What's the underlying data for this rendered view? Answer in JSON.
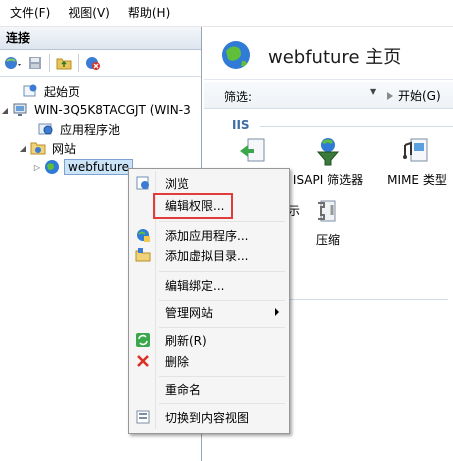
{
  "menubar": {
    "items": [
      "文件(F)",
      "视图(V)",
      "帮助(H)"
    ]
  },
  "connections": {
    "title": "连接",
    "tree": [
      {
        "label": "起始页",
        "icon": "start-page-icon"
      },
      {
        "label": "WIN-3Q5K8TACGJT (WIN-3",
        "icon": "server-icon"
      },
      {
        "label": "应用程序池",
        "icon": "app-pool-icon"
      },
      {
        "label": "网站",
        "icon": "sites-folder-icon"
      },
      {
        "label": "webfuture",
        "icon": "globe-icon"
      }
    ]
  },
  "home": {
    "title": "webfuture 主页",
    "filter_label": "筛选:",
    "start_label": "开始(G)",
    "group_iis": "IIS",
    "features": [
      {
        "label": "ISAPI 筛选器",
        "icon": "isapi-filter-icon"
      },
      {
        "label": "MIME 类型",
        "icon": "mime-types-icon"
      },
      {
        "label": "压缩",
        "icon": "compression-icon"
      }
    ],
    "partial_feature_label": "示"
  },
  "context_menu": {
    "items": [
      {
        "label": "浏览",
        "icon": "browse-icon"
      },
      {
        "label": "编辑权限...",
        "icon": ""
      },
      {
        "label": "添加应用程序...",
        "icon": "add-application-icon"
      },
      {
        "label": "添加虚拟目录...",
        "icon": "add-virtual-dir-icon"
      },
      {
        "label": "编辑绑定...",
        "icon": ""
      },
      {
        "label": "管理网站",
        "icon": ""
      },
      {
        "label": "刷新(R)",
        "icon": "refresh-icon"
      },
      {
        "label": "删除",
        "icon": "delete-icon"
      },
      {
        "label": "重命名",
        "icon": ""
      },
      {
        "label": "切换到内容视图",
        "icon": "content-view-icon"
      }
    ]
  },
  "colors": {
    "highlight": "#e23b3b",
    "selection": "#cce4f7"
  }
}
